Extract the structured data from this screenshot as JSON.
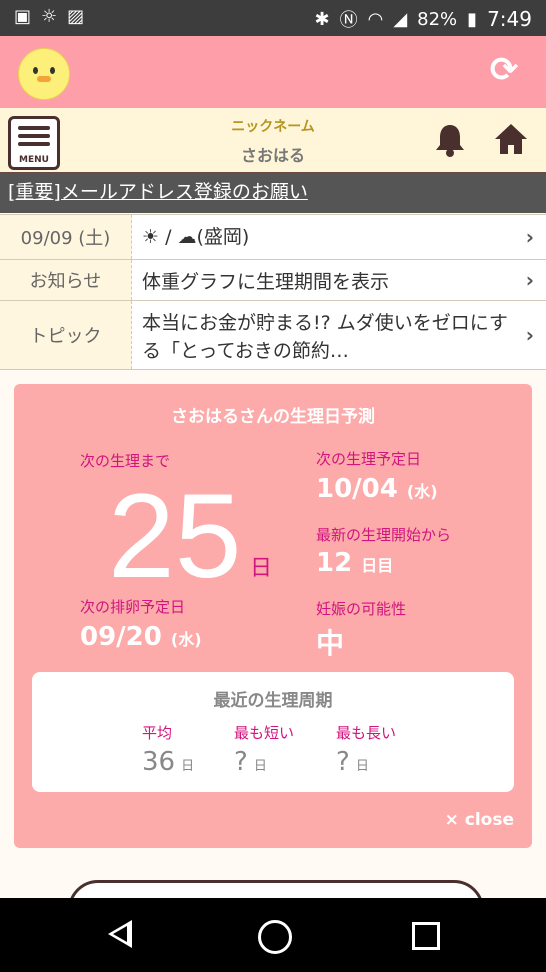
{
  "status_bar": {
    "time": "7:49",
    "battery": "82%",
    "icons": [
      "contacts-icon",
      "weather-icon",
      "image-icon",
      "bluetooth-icon",
      "nfc-icon",
      "wifi-icon",
      "signal-icon",
      "battery-icon"
    ]
  },
  "header": {
    "logo": "chick-icon",
    "refresh_icon": "refresh-icon",
    "colors": {
      "bg": "#fd9ea9"
    }
  },
  "subheader": {
    "menu_label": "MENU",
    "nickname_label": "ニックネーム",
    "nickname": "さおはる",
    "bell_icon": "bell-icon",
    "home_icon": "home-icon"
  },
  "notice": {
    "text": "[重要]メールアドレス登録のお願い"
  },
  "info_rows": [
    {
      "label": "09/09 (土)",
      "value": "☀ / ☁(盛岡)"
    },
    {
      "label": "お知らせ",
      "value": "体重グラフに生理期間を表示"
    },
    {
      "label": "トピック",
      "value": "本当にお金が貯まる!? ムダ使いをゼロにする「とっておきの節約…"
    }
  ],
  "prediction": {
    "title": "さおはるさんの生理日予測",
    "until_label": "次の生理まで",
    "until_value": "25",
    "until_unit": "日",
    "next_period_label": "次の生理予定日",
    "next_period_date": "10/04",
    "next_period_dow": "(水)",
    "since_label": "最新の生理開始から",
    "since_value": "12",
    "since_unit": "日目",
    "ovulation_label": "次の排卵予定日",
    "ovulation_date": "09/20",
    "ovulation_dow": "(水)",
    "pregnancy_label": "妊娠の可能性",
    "pregnancy_value": "中",
    "cycle": {
      "title": "最近の生理周期",
      "avg_label": "平均",
      "avg_value": "36",
      "shortest_label": "最も短い",
      "shortest_value": "?",
      "longest_label": "最も長い",
      "longest_value": "?",
      "unit": "日"
    },
    "close_label": "× close"
  },
  "nav_bar": [
    "back-icon",
    "home-circle-icon",
    "recent-apps-icon"
  ]
}
